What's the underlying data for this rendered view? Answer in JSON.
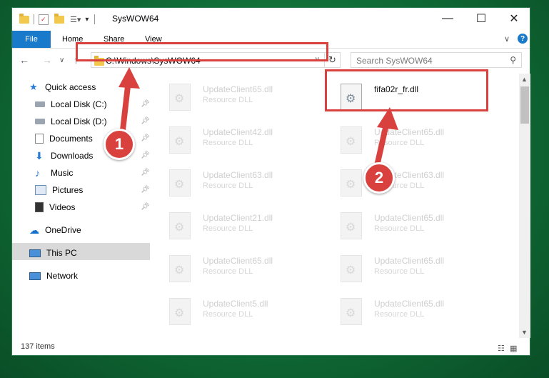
{
  "window": {
    "title": "SysWOW64",
    "controls": {
      "minimize": "—",
      "maximize": "☐",
      "close": "✕"
    }
  },
  "ribbon": {
    "tabs": [
      "File",
      "Home",
      "Share",
      "View"
    ],
    "expand": "∨",
    "help": "?"
  },
  "address": {
    "path": "C:\\Windows\\SysWOW64",
    "dropdown": "∨",
    "refresh": "↻"
  },
  "search": {
    "placeholder": "Search SysWOW64",
    "icon": "search-icon"
  },
  "nav_buttons": {
    "back": "←",
    "forward": "→",
    "recent": "∨",
    "up": "↑"
  },
  "sidebar": {
    "items": [
      {
        "label": "Quick access",
        "icon": "star-icon",
        "pinned": false
      },
      {
        "label": "Local Disk (C:)",
        "icon": "drive-icon",
        "pinned": true
      },
      {
        "label": "Local Disk (D:)",
        "icon": "drive-icon",
        "pinned": true
      },
      {
        "label": "Documents",
        "icon": "documents-icon",
        "pinned": true
      },
      {
        "label": "Downloads",
        "icon": "download-icon",
        "pinned": true
      },
      {
        "label": "Music",
        "icon": "music-icon",
        "pinned": true
      },
      {
        "label": "Pictures",
        "icon": "pictures-icon",
        "pinned": true
      },
      {
        "label": "Videos",
        "icon": "videos-icon",
        "pinned": true
      },
      {
        "label": "OneDrive",
        "icon": "cloud-icon",
        "pinned": false
      },
      {
        "label": "This PC",
        "icon": "computer-icon",
        "pinned": false,
        "selected": true
      },
      {
        "label": "Network",
        "icon": "network-icon",
        "pinned": false
      }
    ]
  },
  "files": [
    {
      "name": "UpdateClient65.dll",
      "type": "Resource DLL"
    },
    {
      "name": "fifa02r_fr.dll",
      "type": "",
      "active": true
    },
    {
      "name": "UpdateClient42.dll",
      "type": "Resource DLL"
    },
    {
      "name": "UpdateClient65.dll",
      "type": "Resource DLL"
    },
    {
      "name": "UpdateClient63.dll",
      "type": "Resource DLL"
    },
    {
      "name": "UpdateClient63.dll",
      "type": "Resource DLL"
    },
    {
      "name": "UpdateClient21.dll",
      "type": "Resource DLL"
    },
    {
      "name": "UpdateClient65.dll",
      "type": "Resource DLL"
    },
    {
      "name": "UpdateClient65.dll",
      "type": "Resource DLL"
    },
    {
      "name": "UpdateClient65.dll",
      "type": "Resource DLL"
    },
    {
      "name": "UpdateClient5.dll",
      "type": "Resource DLL"
    },
    {
      "name": "UpdateClient65.dll",
      "type": "Resource DLL"
    }
  ],
  "status": {
    "count": "137 items"
  },
  "badges": {
    "one": "1",
    "two": "2"
  },
  "colors": {
    "accent": "#1979ca",
    "highlight": "#d9413f",
    "selected": "#d9d9d9"
  }
}
